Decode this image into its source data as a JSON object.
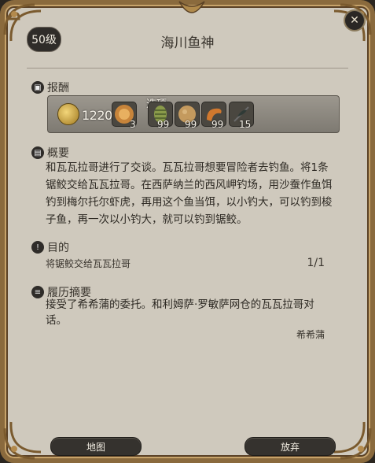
{
  "header": {
    "level": "50级",
    "title": "海川鱼神"
  },
  "rewards": {
    "heading": "报酬",
    "choice_label": "选项",
    "gil": "1220",
    "items": [
      {
        "name": "food-plate-icon",
        "count": "3"
      },
      {
        "name": "lure-icon",
        "count": "99"
      },
      {
        "name": "bread-bait-icon",
        "count": "99"
      },
      {
        "name": "shrimp-bait-icon",
        "count": "99"
      },
      {
        "name": "fly-bait-icon",
        "count": "15"
      }
    ]
  },
  "summary": {
    "heading": "概要",
    "lines": [
      "和瓦瓦拉哥进行了交谈。瓦瓦拉哥想要冒险者去钓鱼。将1条",
      "锯鲛交给瓦瓦拉哥。在西萨纳兰的西风岬钓场，用沙蚕作鱼饵",
      "钓到梅尔托尔虾虎，再用这个鱼当饵，以小钓大，可以钓到梭",
      "子鱼，再一次以小钓大，就可以钓到锯鲛。"
    ]
  },
  "objective": {
    "heading": "目的",
    "text": "将锯鲛交给瓦瓦拉哥",
    "progress": "1/1"
  },
  "history": {
    "heading": "履历摘要",
    "lines": [
      "接受了希希蒲的委托。和利姆萨·罗敏萨网仓的瓦瓦拉哥对",
      "话。"
    ],
    "npc": "希希蒲"
  },
  "buttons": {
    "map": "地图",
    "abandon": "放弃"
  }
}
